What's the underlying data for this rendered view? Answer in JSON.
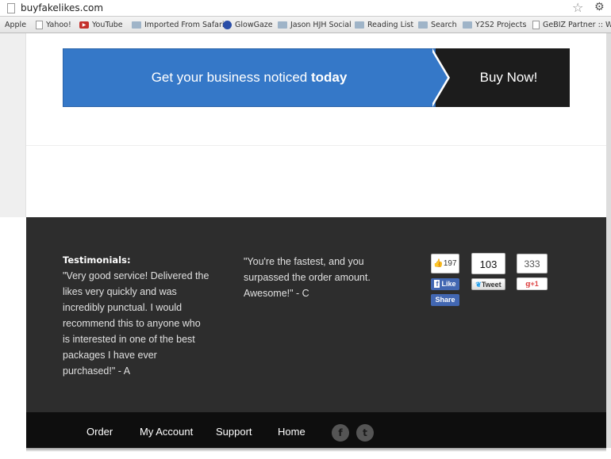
{
  "browser": {
    "url": "buyfakelikes.com",
    "bookmarks": [
      "Apple",
      "Yahoo!",
      "YouTube",
      "Imported From Safari",
      "GlowGaze",
      "Jason HJH Social",
      "Reading List",
      "Search",
      "Y2S2 Projects",
      "GeBIZ Partner :: We"
    ]
  },
  "banner": {
    "text": "Get your business noticed ",
    "text_bold": "today",
    "buy_label": "Buy Now!",
    "color": "#3578c8"
  },
  "testimonials": {
    "heading": "Testimonials:",
    "quote1": "\"Very good service! Delivered the likes very quickly and was incredibly punctual. I would recommend this to anyone who is interested in one of the best packages I have ever purchased!\" - A",
    "quote2": "\"You're the fastest, and you surpassed the order amount. Awesome!\" - C"
  },
  "social": {
    "fb_count": "197",
    "fb_like": "Like",
    "fb_share": "Share",
    "tw_count": "103",
    "tw_label": "Tweet",
    "gp_count": "333",
    "gp_label": "+1"
  },
  "nav": {
    "items": [
      "Order",
      "My Account",
      "Support",
      "Home"
    ],
    "icons": [
      "facebook-icon",
      "twitter-icon"
    ]
  }
}
